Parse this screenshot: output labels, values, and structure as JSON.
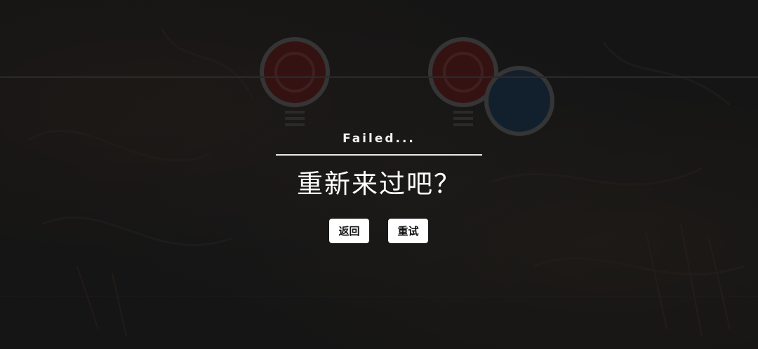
{
  "game": {
    "result_title": "Failed...",
    "prompt": "重新来过吧？",
    "buttons": {
      "back_label": "返回",
      "retry_label": "重试"
    },
    "note_colors": {
      "red": "#8a1f1f",
      "blue": "#1f3f66"
    }
  }
}
